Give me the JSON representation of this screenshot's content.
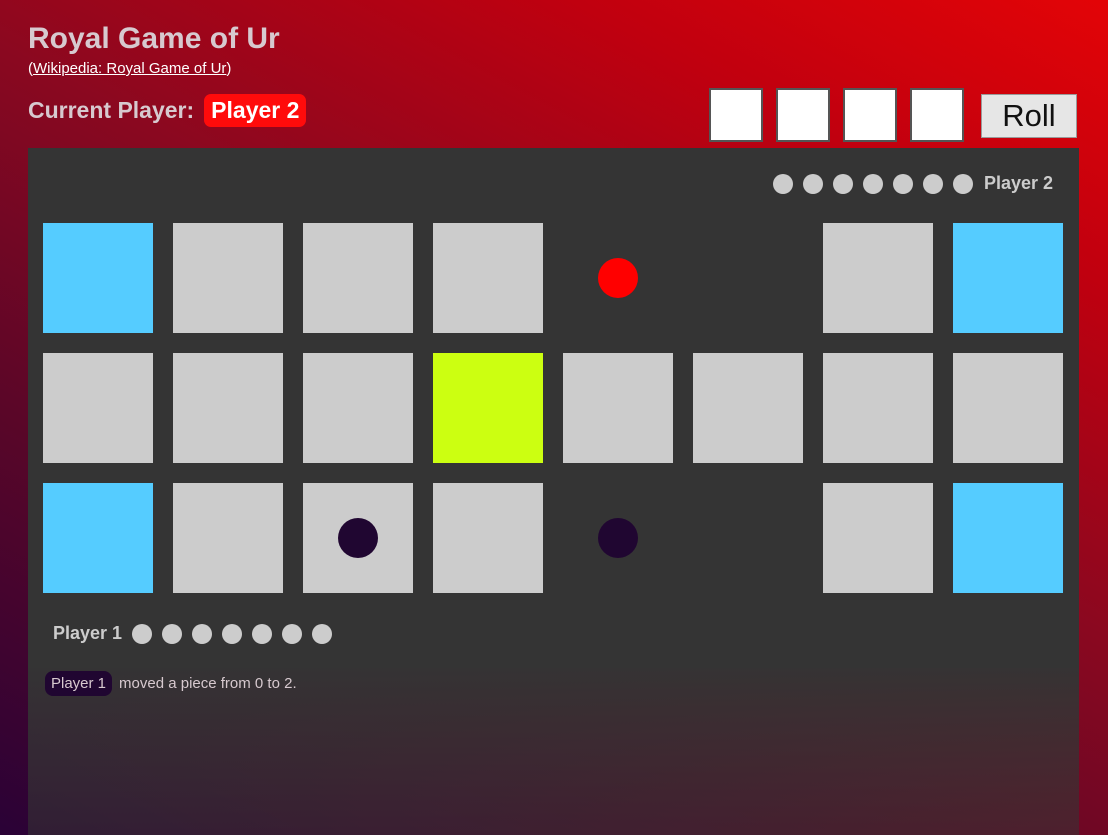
{
  "header": {
    "title": "Royal Game of Ur",
    "wiki_open": "(",
    "wiki_link": "Wikipedia: Royal Game of Ur",
    "wiki_close": ")"
  },
  "status": {
    "current_label": "Current Player:",
    "current_player": "Player 2",
    "current_player_color": "#ff0b0b"
  },
  "controls": {
    "dice": [
      "",
      "",
      "",
      ""
    ],
    "roll_label": "Roll"
  },
  "players": {
    "player1": {
      "label": "Player 1",
      "pool_count": 7,
      "color": "#200631"
    },
    "player2": {
      "label": "Player 2",
      "pool_count": 7,
      "color": "#ff0000"
    }
  },
  "board": {
    "rows": [
      [
        "rosette",
        "normal",
        "normal",
        "normal",
        "empty",
        "empty",
        "normal",
        "rosette"
      ],
      [
        "normal",
        "normal",
        "normal",
        "highlight",
        "normal",
        "normal",
        "normal",
        "normal"
      ],
      [
        "rosette",
        "normal",
        "normal",
        "normal",
        "empty",
        "empty",
        "normal",
        "rosette"
      ]
    ],
    "pieces": [
      {
        "row": 0,
        "col": 4,
        "player": "p2"
      },
      {
        "row": 2,
        "col": 2,
        "player": "p1"
      },
      {
        "row": 2,
        "col": 4,
        "player": "p1"
      }
    ],
    "colors": {
      "normal": "#cccccc",
      "rosette": "#55ccff",
      "highlight": "#ccff11"
    }
  },
  "log": {
    "player": "Player 1",
    "message": "moved a piece from 0 to 2."
  }
}
